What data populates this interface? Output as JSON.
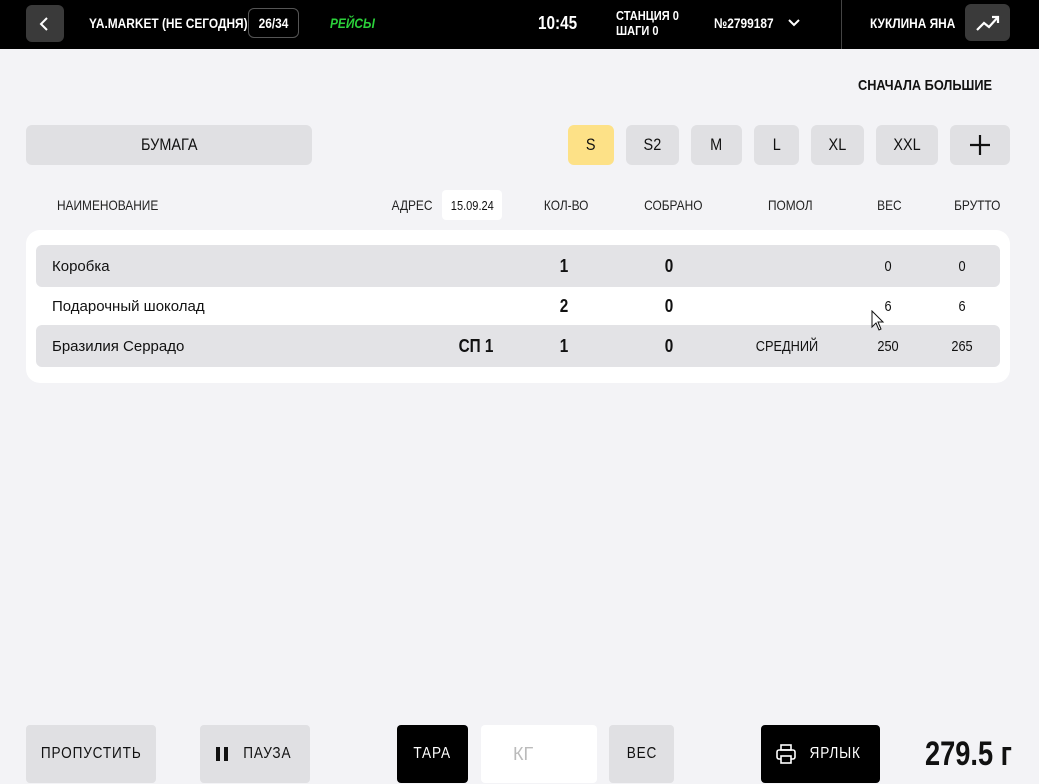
{
  "header": {
    "title": "YA.MARKET (НЕ СЕГОДНЯ)",
    "counter": "26/34",
    "flights": "РЕЙСЫ",
    "time": "10:45",
    "station_line1": "СТАНЦИЯ 0",
    "station_line2": "ШАГИ 0",
    "order": "№2799187",
    "user": "КУКЛИНА ЯНА"
  },
  "sort_label": "СНАЧАЛА БОЛЬШИЕ",
  "material": "БУМАГА",
  "sizes": [
    "S",
    "S2",
    "M",
    "L",
    "XL",
    "XXL"
  ],
  "active_size": "S",
  "columns": {
    "name": "НАИМЕНОВАНИЕ",
    "address": "АДРЕС",
    "date": "15.09.24",
    "qty": "КОЛ-ВО",
    "collected": "СОБРАНО",
    "grind": "ПОМОЛ",
    "weight": "ВЕС",
    "gross": "БРУТТО"
  },
  "rows": [
    {
      "name": "Коробка",
      "address": "",
      "qty": "1",
      "collected": "0",
      "grind": "",
      "weight": "0",
      "gross": "0"
    },
    {
      "name": "Подарочный шоколад",
      "address": "",
      "qty": "2",
      "collected": "0",
      "grind": "",
      "weight": "6",
      "gross": "6"
    },
    {
      "name": "Бразилия Серрадо",
      "address": "СП 1",
      "qty": "1",
      "collected": "0",
      "grind": "СРЕДНИЙ",
      "weight": "250",
      "gross": "265"
    }
  ],
  "bottom": {
    "skip": "ПРОПУСТИТЬ",
    "pause": "ПАУЗА",
    "tare": "ТАРА",
    "kg_placeholder": "КГ",
    "weigh": "ВЕС",
    "label": "ЯРЛЫК",
    "total": "279.5 г"
  },
  "colors": {
    "topbar": "#000000",
    "flights": "#2bd13a",
    "active_chip": "#fde187"
  },
  "icons": [
    "chevron-left-icon",
    "chevron-down-icon",
    "trending-up-icon",
    "plus-icon",
    "pause-icon",
    "printer-icon"
  ]
}
